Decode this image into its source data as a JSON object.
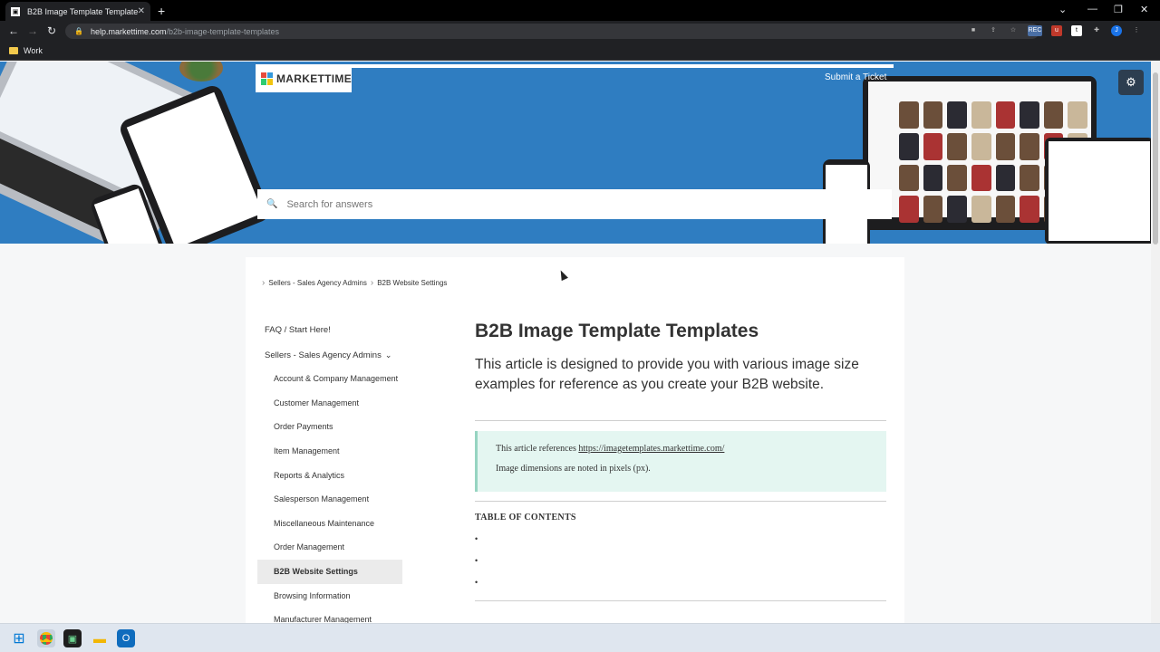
{
  "browser": {
    "tab_title": "B2B Image Template Templates",
    "url_host": "help.markettime.com",
    "url_path": "/b2b-image-template-templates",
    "bookmark": "Work",
    "ext_rec": "REC"
  },
  "header": {
    "logo_text": "MARKETTIME",
    "submit_ticket": "Submit a Ticket",
    "search_placeholder": "Search for answers"
  },
  "breadcrumb": [
    "Sellers - Sales Agency Admins",
    "B2B Website Settings"
  ],
  "sidebar": {
    "top_items": [
      "FAQ / Start Here!",
      "Sellers - Sales Agency Admins"
    ],
    "sub_items": [
      "Account & Company Management",
      "Customer Management",
      "Order Payments",
      "Item Management",
      "Reports & Analytics",
      "Salesperson Management",
      "Miscellaneous Maintenance",
      "Order Management",
      "B2B Website Settings",
      "Browsing Information",
      "Manufacturer Management"
    ],
    "active": "B2B Website Settings"
  },
  "article": {
    "title": "B2B Image Template Templates",
    "subtitle": "This article is designed to provide you with various image size examples for reference as you create your B2B website.",
    "callout_prefix": "This article references ",
    "callout_link": "https://imagetemplates.markettime.com/",
    "callout_line2": "Image dimensions are noted in pixels (px).",
    "toc_title": "TABLE OF CONTENTS",
    "toc_bullets": [
      "•",
      "•",
      "•"
    ]
  },
  "colors": {
    "hero_blue": "#2f7dc1",
    "callout_bg": "#e4f6f1",
    "callout_border": "#96d4c1"
  }
}
